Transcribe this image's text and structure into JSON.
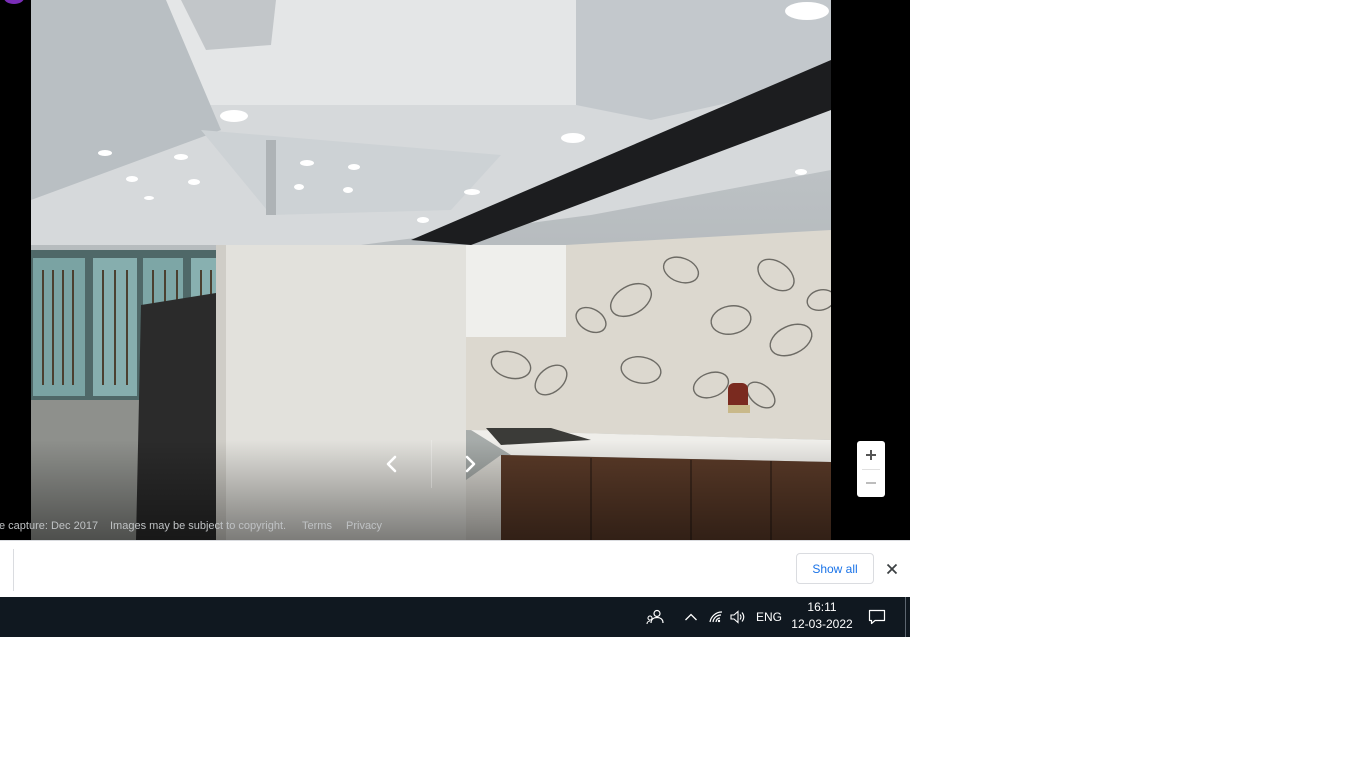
{
  "viewer": {
    "footer": {
      "capture": "e capture: Dec 2017",
      "copyright": "Images may be subject to copyright.",
      "terms": "Terms",
      "privacy": "Privacy"
    },
    "icons": {
      "prev": "chevron-left-icon",
      "next": "chevron-right-icon",
      "zoom_in": "plus-icon",
      "zoom_out": "minus-icon"
    }
  },
  "download_bar": {
    "show_all_label": "Show all",
    "close_icon": "close-icon",
    "accent_color": "#1a73e8"
  },
  "taskbar": {
    "language": "ENG",
    "time": "16:11",
    "date": "12-03-2022",
    "icons": [
      "people-icon",
      "chevron-up-icon",
      "wifi-icon",
      "volume-icon",
      "notification-icon"
    ],
    "background_color": "#101820"
  }
}
